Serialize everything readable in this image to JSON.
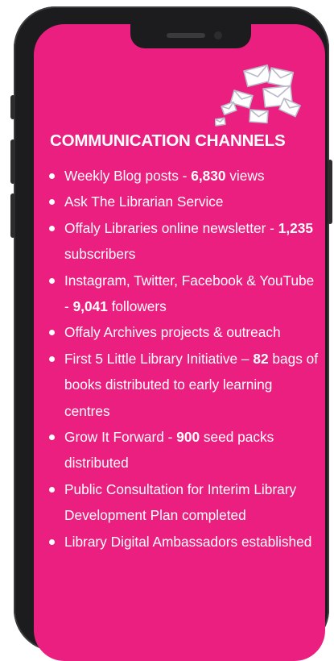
{
  "title": "COMMUNICATION CHANNELS",
  "icon": "envelopes-icon",
  "colors": {
    "screen": "#ea1f7f",
    "text": "#ffffff",
    "frame": "#1c1c1e"
  },
  "items": [
    {
      "pre": "Weekly Blog posts - ",
      "num": "6,830",
      "post": " views"
    },
    {
      "pre": "Ask The Librarian Service",
      "num": "",
      "post": ""
    },
    {
      "pre": "Offaly Libraries online newsletter - ",
      "num": "1,235",
      "post": " subscribers"
    },
    {
      "pre": "Instagram, Twitter, Facebook  & YouTube - ",
      "num": "9,041",
      "post": " followers"
    },
    {
      "pre": "Offaly Archives projects & outreach",
      "num": "",
      "post": ""
    },
    {
      "pre": "First 5 Little Library Initiative – ",
      "num": "82",
      "post": " bags of books distributed to early learning centres"
    },
    {
      "pre": "Grow It Forward - ",
      "num": "900",
      "post": " seed packs distributed"
    },
    {
      "pre": "Public Consultation for Interim Library Development Plan completed",
      "num": "",
      "post": ""
    },
    {
      "pre": "Library Digital Ambassadors established",
      "num": "",
      "post": ""
    }
  ]
}
